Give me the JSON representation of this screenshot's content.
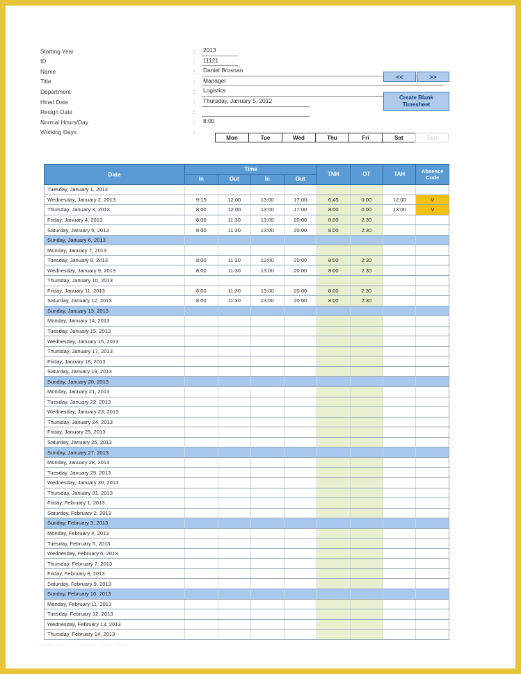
{
  "form": {
    "fields": [
      {
        "label": "Starting Year",
        "value": "2013",
        "underline": "tiny"
      },
      {
        "label": "ID",
        "value": "11121",
        "underline": "tiny"
      },
      {
        "label": "Name",
        "value": "Daniel Brosnan",
        "underline": "long"
      },
      {
        "label": "Title",
        "value": "Manager",
        "underline": "long"
      },
      {
        "label": "Department",
        "value": "Logistics",
        "underline": "long"
      },
      {
        "label": "Hired Date",
        "value": "Thursday, January 5, 2012",
        "underline": "short"
      },
      {
        "label": "Resign Date",
        "value": "",
        "underline": "short"
      },
      {
        "label": "Normal Hours/Day",
        "value": "8:00",
        "underline": "none"
      },
      {
        "label": "Working Days",
        "value": "",
        "underline": "none"
      }
    ],
    "separator": ":"
  },
  "buttons": {
    "prev": "<<",
    "next": ">>",
    "create_blank_line1": "Create Blank",
    "create_blank_line2": "Timesheet"
  },
  "working_days": [
    {
      "label": "Mon",
      "enabled": true
    },
    {
      "label": "Tue",
      "enabled": true
    },
    {
      "label": "Wed",
      "enabled": true
    },
    {
      "label": "Thu",
      "enabled": true
    },
    {
      "label": "Fri",
      "enabled": true
    },
    {
      "label": "Sat",
      "enabled": true
    },
    {
      "label": "Sun",
      "enabled": false
    }
  ],
  "table": {
    "headers": {
      "date": "Date",
      "time_group": "Time",
      "in1": "In",
      "out1": "Out",
      "in2": "In",
      "out2": "Out",
      "tnh": "TNH",
      "ot": "OT",
      "tah": "TAH",
      "absence_line1": "Absence",
      "absence_line2": "Code"
    },
    "rows": [
      {
        "date": "Tuesday, January 1, 2013",
        "in1": "",
        "out1": "",
        "in2": "",
        "out2": "",
        "tnh": "",
        "ot": "",
        "tah": "",
        "abs": "",
        "sunday": false
      },
      {
        "date": "Wednesday, January 2, 2013",
        "in1": "9:15",
        "out1": "12:00",
        "in2": "13:00",
        "out2": "17:00",
        "tnh": "6:45",
        "ot": "0:00",
        "tah": "12:00",
        "abs": "V",
        "sunday": false
      },
      {
        "date": "Thursday, January 3, 2013",
        "in1": "8:00",
        "out1": "12:00",
        "in2": "13:00",
        "out2": "17:00",
        "tnh": "8:00",
        "ot": "0:00",
        "tah": "13:00",
        "abs": "V",
        "sunday": false
      },
      {
        "date": "Friday, January 4, 2013",
        "in1": "8:00",
        "out1": "11:30",
        "in2": "13:00",
        "out2": "20:00",
        "tnh": "8:00",
        "ot": "2:30",
        "tah": "",
        "abs": "",
        "sunday": false
      },
      {
        "date": "Saturday, January 5, 2013",
        "in1": "8:00",
        "out1": "11:30",
        "in2": "13:00",
        "out2": "20:00",
        "tnh": "8:00",
        "ot": "2:30",
        "tah": "",
        "abs": "",
        "sunday": false
      },
      {
        "date": "Sunday, January 6, 2013",
        "in1": "",
        "out1": "",
        "in2": "",
        "out2": "",
        "tnh": "",
        "ot": "",
        "tah": "",
        "abs": "",
        "sunday": true
      },
      {
        "date": "Monday, January 7, 2013",
        "in1": "",
        "out1": "",
        "in2": "",
        "out2": "",
        "tnh": "",
        "ot": "",
        "tah": "",
        "abs": "",
        "sunday": false
      },
      {
        "date": "Tuesday, January 8, 2013",
        "in1": "8:00",
        "out1": "11:30",
        "in2": "13:00",
        "out2": "20:00",
        "tnh": "8:00",
        "ot": "2:30",
        "tah": "",
        "abs": "",
        "sunday": false
      },
      {
        "date": "Wednesday, January 9, 2013",
        "in1": "8:00",
        "out1": "11:30",
        "in2": "13:00",
        "out2": "20:00",
        "tnh": "8:00",
        "ot": "2:30",
        "tah": "",
        "abs": "",
        "sunday": false
      },
      {
        "date": "Thursday, January 10, 2013",
        "in1": "",
        "out1": "",
        "in2": "",
        "out2": "",
        "tnh": "",
        "ot": "",
        "tah": "",
        "abs": "",
        "sunday": false
      },
      {
        "date": "Friday, January 11, 2013",
        "in1": "8:00",
        "out1": "11:30",
        "in2": "13:00",
        "out2": "20:00",
        "tnh": "8:00",
        "ot": "2:30",
        "tah": "",
        "abs": "",
        "sunday": false
      },
      {
        "date": "Saturday, January 12, 2013",
        "in1": "8:00",
        "out1": "11:30",
        "in2": "13:00",
        "out2": "20:00",
        "tnh": "8:00",
        "ot": "2:30",
        "tah": "",
        "abs": "",
        "sunday": false
      },
      {
        "date": "Sunday, January 13, 2013",
        "in1": "",
        "out1": "",
        "in2": "",
        "out2": "",
        "tnh": "",
        "ot": "",
        "tah": "",
        "abs": "",
        "sunday": true
      },
      {
        "date": "Monday, January 14, 2013",
        "in1": "",
        "out1": "",
        "in2": "",
        "out2": "",
        "tnh": "",
        "ot": "",
        "tah": "",
        "abs": "",
        "sunday": false
      },
      {
        "date": "Tuesday, January 15, 2013",
        "in1": "",
        "out1": "",
        "in2": "",
        "out2": "",
        "tnh": "",
        "ot": "",
        "tah": "",
        "abs": "",
        "sunday": false
      },
      {
        "date": "Wednesday, January 16, 2013",
        "in1": "",
        "out1": "",
        "in2": "",
        "out2": "",
        "tnh": "",
        "ot": "",
        "tah": "",
        "abs": "",
        "sunday": false
      },
      {
        "date": "Thursday, January 17, 2013",
        "in1": "",
        "out1": "",
        "in2": "",
        "out2": "",
        "tnh": "",
        "ot": "",
        "tah": "",
        "abs": "",
        "sunday": false
      },
      {
        "date": "Friday, January 18, 2013",
        "in1": "",
        "out1": "",
        "in2": "",
        "out2": "",
        "tnh": "",
        "ot": "",
        "tah": "",
        "abs": "",
        "sunday": false
      },
      {
        "date": "Saturday, January 19, 2013",
        "in1": "",
        "out1": "",
        "in2": "",
        "out2": "",
        "tnh": "",
        "ot": "",
        "tah": "",
        "abs": "",
        "sunday": false
      },
      {
        "date": "Sunday, January 20, 2013",
        "in1": "",
        "out1": "",
        "in2": "",
        "out2": "",
        "tnh": "",
        "ot": "",
        "tah": "",
        "abs": "",
        "sunday": true
      },
      {
        "date": "Monday, January 21, 2013",
        "in1": "",
        "out1": "",
        "in2": "",
        "out2": "",
        "tnh": "",
        "ot": "",
        "tah": "",
        "abs": "",
        "sunday": false
      },
      {
        "date": "Tuesday, January 22, 2013",
        "in1": "",
        "out1": "",
        "in2": "",
        "out2": "",
        "tnh": "",
        "ot": "",
        "tah": "",
        "abs": "",
        "sunday": false
      },
      {
        "date": "Wednesday, January 23, 2013",
        "in1": "",
        "out1": "",
        "in2": "",
        "out2": "",
        "tnh": "",
        "ot": "",
        "tah": "",
        "abs": "",
        "sunday": false
      },
      {
        "date": "Thursday, January 24, 2013",
        "in1": "",
        "out1": "",
        "in2": "",
        "out2": "",
        "tnh": "",
        "ot": "",
        "tah": "",
        "abs": "",
        "sunday": false
      },
      {
        "date": "Friday, January 25, 2013",
        "in1": "",
        "out1": "",
        "in2": "",
        "out2": "",
        "tnh": "",
        "ot": "",
        "tah": "",
        "abs": "",
        "sunday": false
      },
      {
        "date": "Saturday, January 26, 2013",
        "in1": "",
        "out1": "",
        "in2": "",
        "out2": "",
        "tnh": "",
        "ot": "",
        "tah": "",
        "abs": "",
        "sunday": false
      },
      {
        "date": "Sunday, January 27, 2013",
        "in1": "",
        "out1": "",
        "in2": "",
        "out2": "",
        "tnh": "",
        "ot": "",
        "tah": "",
        "abs": "",
        "sunday": true
      },
      {
        "date": "Monday, January 28, 2013",
        "in1": "",
        "out1": "",
        "in2": "",
        "out2": "",
        "tnh": "",
        "ot": "",
        "tah": "",
        "abs": "",
        "sunday": false
      },
      {
        "date": "Tuesday, January 29, 2013",
        "in1": "",
        "out1": "",
        "in2": "",
        "out2": "",
        "tnh": "",
        "ot": "",
        "tah": "",
        "abs": "",
        "sunday": false
      },
      {
        "date": "Wednesday, January 30, 2013",
        "in1": "",
        "out1": "",
        "in2": "",
        "out2": "",
        "tnh": "",
        "ot": "",
        "tah": "",
        "abs": "",
        "sunday": false
      },
      {
        "date": "Thursday, January 31, 2013",
        "in1": "",
        "out1": "",
        "in2": "",
        "out2": "",
        "tnh": "",
        "ot": "",
        "tah": "",
        "abs": "",
        "sunday": false
      },
      {
        "date": "Friday, February 1, 2013",
        "in1": "",
        "out1": "",
        "in2": "",
        "out2": "",
        "tnh": "",
        "ot": "",
        "tah": "",
        "abs": "",
        "sunday": false
      },
      {
        "date": "Saturday, February 2, 2013",
        "in1": "",
        "out1": "",
        "in2": "",
        "out2": "",
        "tnh": "",
        "ot": "",
        "tah": "",
        "abs": "",
        "sunday": false
      },
      {
        "date": "Sunday, February 3, 2013",
        "in1": "",
        "out1": "",
        "in2": "",
        "out2": "",
        "tnh": "",
        "ot": "",
        "tah": "",
        "abs": "",
        "sunday": true
      },
      {
        "date": "Monday, February 4, 2013",
        "in1": "",
        "out1": "",
        "in2": "",
        "out2": "",
        "tnh": "",
        "ot": "",
        "tah": "",
        "abs": "",
        "sunday": false
      },
      {
        "date": "Tuesday, February 5, 2013",
        "in1": "",
        "out1": "",
        "in2": "",
        "out2": "",
        "tnh": "",
        "ot": "",
        "tah": "",
        "abs": "",
        "sunday": false
      },
      {
        "date": "Wednesday, February 6, 2013",
        "in1": "",
        "out1": "",
        "in2": "",
        "out2": "",
        "tnh": "",
        "ot": "",
        "tah": "",
        "abs": "",
        "sunday": false
      },
      {
        "date": "Thursday, February 7, 2013",
        "in1": "",
        "out1": "",
        "in2": "",
        "out2": "",
        "tnh": "",
        "ot": "",
        "tah": "",
        "abs": "",
        "sunday": false
      },
      {
        "date": "Friday, February 8, 2013",
        "in1": "",
        "out1": "",
        "in2": "",
        "out2": "",
        "tnh": "",
        "ot": "",
        "tah": "",
        "abs": "",
        "sunday": false
      },
      {
        "date": "Saturday, February 9, 2013",
        "in1": "",
        "out1": "",
        "in2": "",
        "out2": "",
        "tnh": "",
        "ot": "",
        "tah": "",
        "abs": "",
        "sunday": false
      },
      {
        "date": "Sunday, February 10, 2013",
        "in1": "",
        "out1": "",
        "in2": "",
        "out2": "",
        "tnh": "",
        "ot": "",
        "tah": "",
        "abs": "",
        "sunday": true
      },
      {
        "date": "Monday, February 11, 2013",
        "in1": "",
        "out1": "",
        "in2": "",
        "out2": "",
        "tnh": "",
        "ot": "",
        "tah": "",
        "abs": "",
        "sunday": false
      },
      {
        "date": "Tuesday, February 12, 2013",
        "in1": "",
        "out1": "",
        "in2": "",
        "out2": "",
        "tnh": "",
        "ot": "",
        "tah": "",
        "abs": "",
        "sunday": false
      },
      {
        "date": "Wednesday, February 13, 2013",
        "in1": "",
        "out1": "",
        "in2": "",
        "out2": "",
        "tnh": "",
        "ot": "",
        "tah": "",
        "abs": "",
        "sunday": false
      },
      {
        "date": "Thursday, February 14, 2013",
        "in1": "",
        "out1": "",
        "in2": "",
        "out2": "",
        "tnh": "",
        "ot": "",
        "tah": "",
        "abs": "",
        "sunday": false
      }
    ]
  },
  "watermark": "www.templatesamples.com",
  "colors": {
    "page_border": "#e8c43a",
    "header_blue": "#5b9bd5",
    "sunday_blue": "#a8c8ee",
    "green_fill": "#e8f0cf",
    "absence_orange": "#f5c113",
    "button_fill": "#aecbec",
    "button_text": "#12407f"
  }
}
